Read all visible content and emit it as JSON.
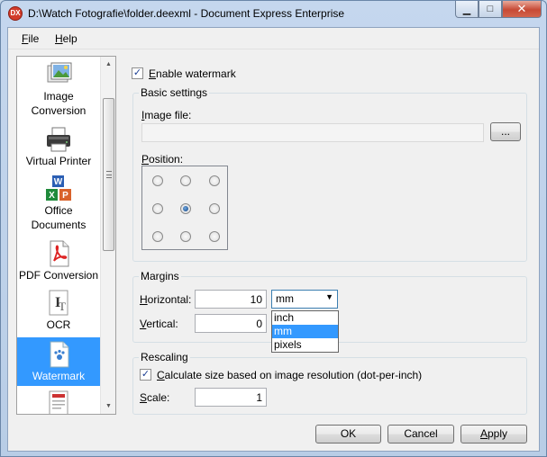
{
  "window": {
    "title": "D:\\Watch Fotografie\\folder.deexml - Document Express Enterprise",
    "app_icon_text": "DX",
    "controls": {
      "minimize": "▁",
      "maximize": "□",
      "close": "✕"
    }
  },
  "menu": {
    "file": {
      "accel": "F",
      "rest": "ile"
    },
    "help": {
      "accel": "H",
      "rest": "elp"
    }
  },
  "nav": {
    "items": [
      {
        "line1": "Image",
        "line2": "Conversion",
        "icon": "image-conversion-icon"
      },
      {
        "line1": "Virtual Printer",
        "line2": "",
        "icon": "printer-icon"
      },
      {
        "line1": "Office",
        "line2": "Documents",
        "icon": "office-documents-icon"
      },
      {
        "line1": "PDF Conversion",
        "line2": "",
        "icon": "pdf-icon"
      },
      {
        "line1": "OCR",
        "line2": "",
        "icon": "ocr-icon"
      },
      {
        "line1": "Watermark",
        "line2": "",
        "icon": "watermark-icon",
        "selected": true
      }
    ],
    "scroll_up": "▲",
    "scroll_down": "▼"
  },
  "watermark": {
    "enable_label_accel": "E",
    "enable_label_rest": "nable watermark",
    "enabled": true,
    "check_mark": "✓"
  },
  "basic_settings": {
    "title": "Basic settings",
    "image_file_accel": "I",
    "image_file_rest": "mage file:",
    "image_file_value": "",
    "browse_label": "...",
    "position_accel": "P",
    "position_rest": "osition:",
    "position_selected": "middle-center"
  },
  "margins": {
    "title": "Margins",
    "horizontal_accel": "H",
    "horizontal_rest": "orizontal:",
    "horizontal_value": "10",
    "vertical_accel": "V",
    "vertical_rest": "ertical:",
    "vertical_value": "0",
    "unit_selected": "mm",
    "unit_arrow": "▼",
    "unit_options": [
      "inch",
      "mm",
      "pixels"
    ]
  },
  "rescaling": {
    "title": "Rescaling",
    "calc_accel": "C",
    "calc_rest": "alculate size based on image resolution (dot-per-inch)",
    "calc_checked": true,
    "scale_accel": "S",
    "scale_rest": "cale:",
    "scale_value": "1"
  },
  "buttons": {
    "ok": "OK",
    "cancel": "Cancel",
    "apply_accel": "A",
    "apply_rest": "pply"
  },
  "colors": {
    "selection": "#3399ff",
    "title_gradient": "#c5d7ee",
    "close_button": "#c74a35"
  }
}
